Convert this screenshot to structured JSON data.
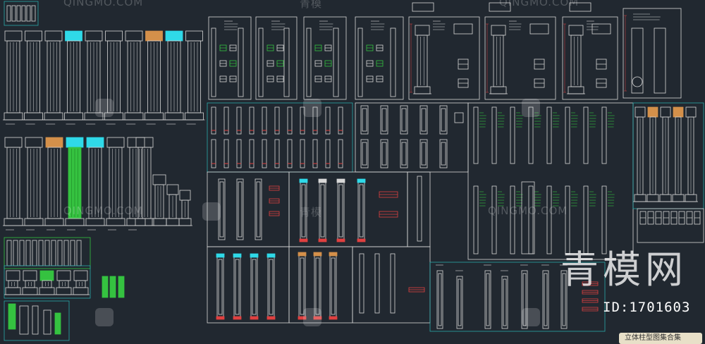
{
  "watermark": {
    "brand": "QINGMO.COM",
    "brand_cn": "青模",
    "big_text": "青模网",
    "id_text": "ID:1701603"
  },
  "bottom_tag": "立体柱型图集合集",
  "colors": {
    "background": "#212830",
    "line": "#d8d8d8",
    "frame": "#2aa8a8",
    "cyan": "#2fd9e8",
    "green": "#35c240",
    "orange": "#d4904a",
    "red": "#e04040",
    "yellow": "#e8d040"
  }
}
